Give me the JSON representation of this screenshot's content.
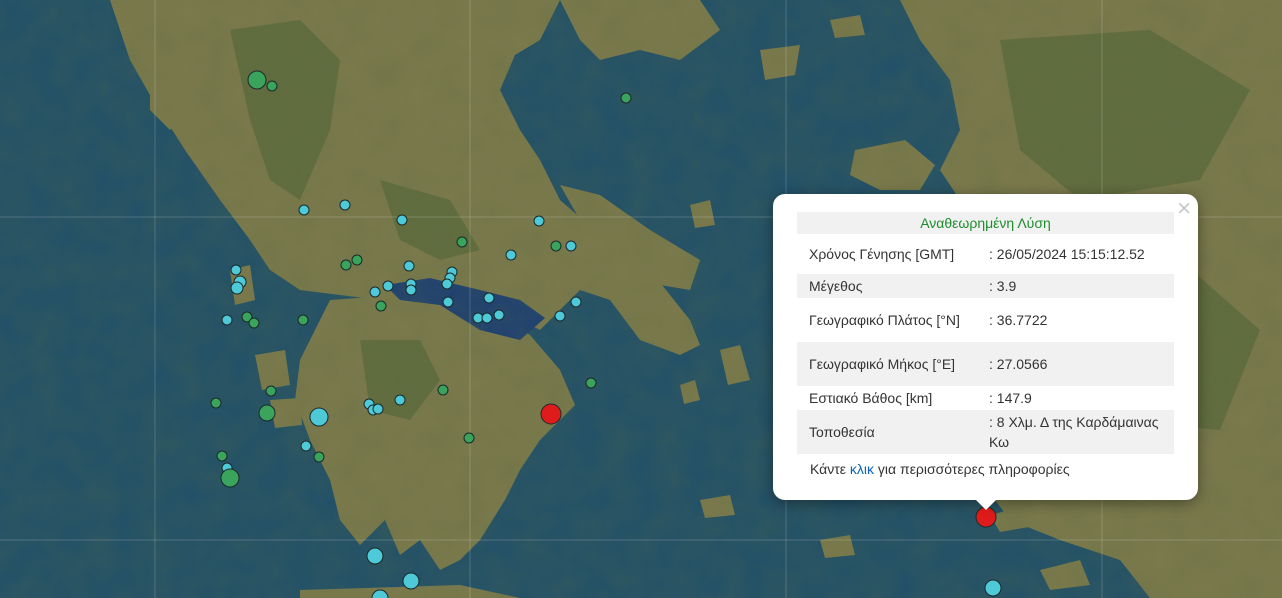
{
  "map": {
    "colors": {
      "sea": "#21506a",
      "land": "#7b7a4c",
      "mountain": "#5d6b3c",
      "green_marker": "#3aa35c",
      "cyan_marker": "#4ec9d8",
      "red_marker": "#e01b1b"
    },
    "markers_description": "earthquake epicenters",
    "marker_count": 58
  },
  "popup": {
    "header": "Αναθεωρημένη Λύση",
    "close_icon": "×",
    "rows": [
      {
        "label": "Χρόνος Γένησης [GMT]",
        "value": ": 26/05/2024 15:15:12.52"
      },
      {
        "label": "Μέγεθος",
        "value": ": 3.9"
      },
      {
        "label": "Γεωγραφικό Πλάτος [°N]",
        "value": ": 36.7722"
      },
      {
        "label": "Γεωγραφικό Μήκος [°E]",
        "value": ": 27.0566"
      },
      {
        "label": "Εστιακό Βάθος [km]",
        "value": ": 147.9"
      },
      {
        "label": "Τοποθεσία",
        "value": ": 8 Χλμ. Δ της Καρδάμαινας Κω"
      }
    ],
    "more_prefix": "Κάντε ",
    "more_link": "κλικ",
    "more_suffix": " για περισσότερες πληροφορίες"
  }
}
